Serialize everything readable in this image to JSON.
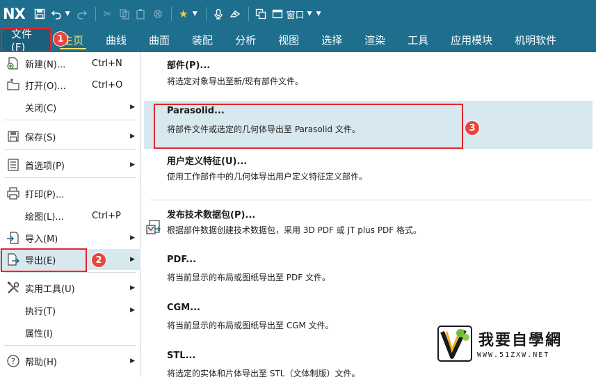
{
  "app": {
    "logo": "NX",
    "window_menu": "窗口"
  },
  "ribbon": {
    "file_tab": "文件(F)",
    "tabs": [
      "主页",
      "曲线",
      "曲面",
      "装配",
      "分析",
      "视图",
      "选择",
      "渲染",
      "工具",
      "应用模块",
      "机明软件"
    ]
  },
  "file_menu": {
    "items": [
      {
        "label": "新建(N)...",
        "shortcut": "Ctrl+N"
      },
      {
        "label": "打开(O)...",
        "shortcut": "Ctrl+O"
      },
      {
        "label": "关闭(C)"
      },
      {
        "label": "保存(S)"
      },
      {
        "label": "首选项(P)"
      },
      {
        "label": "打印(P)..."
      },
      {
        "label": "绘图(L)...",
        "shortcut": "Ctrl+P"
      },
      {
        "label": "导入(M)"
      },
      {
        "label": "导出(E)"
      },
      {
        "label": "实用工具(U)"
      },
      {
        "label": "执行(T)"
      },
      {
        "label": "属性(I)"
      },
      {
        "label": "帮助(H)"
      }
    ]
  },
  "export_menu": {
    "items": [
      {
        "title": "部件(P)...",
        "desc": "将选定对象导出至新/现有部件文件。"
      },
      {
        "title": "Parasolid...",
        "desc": "将部件文件或选定的几何体导出至 Parasolid 文件。"
      },
      {
        "title": "用户定义特征(U)...",
        "desc": "使用工作部件中的几何体导出用户定义特征定义部件。"
      },
      {
        "title": "发布技术数据包(P)...",
        "desc": "根据部件数据创建技术数据包，采用 3D PDF 或 JT plus PDF 格式。"
      },
      {
        "title": "PDF...",
        "desc": "将当前显示的布局或图纸导出至 PDF 文件。"
      },
      {
        "title": "CGM...",
        "desc": "将当前显示的布局或图纸导出至 CGM 文件。"
      },
      {
        "title": "STL...",
        "desc": "将选定的实体和片体导出至 STL（文体制版）文件。"
      }
    ]
  },
  "callouts": [
    "1",
    "2",
    "3"
  ],
  "watermark": {
    "text": "我要自學網",
    "url": "WWW.51ZXW.NET"
  },
  "colors": {
    "titlebar": "#1e6e8e",
    "highlight": "#d8e8ef",
    "callout": "#e0262e",
    "active_tab": "#ffe066"
  }
}
